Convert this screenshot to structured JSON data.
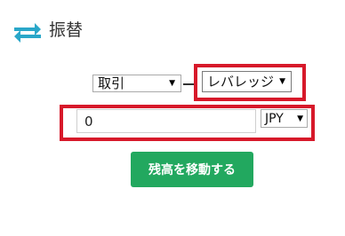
{
  "header": {
    "icon": "transfer-arrows-icon",
    "title": "振替"
  },
  "form": {
    "from_account": {
      "selected": "取引"
    },
    "to_account": {
      "selected": "レバレッジ"
    },
    "amount": {
      "value": "0"
    },
    "currency": {
      "selected": "JPY"
    },
    "submit_label": "残高を移動する"
  },
  "colors": {
    "icon_accent": "#2aa7c9",
    "button": "#22a85f",
    "highlight": "#d7192a"
  }
}
